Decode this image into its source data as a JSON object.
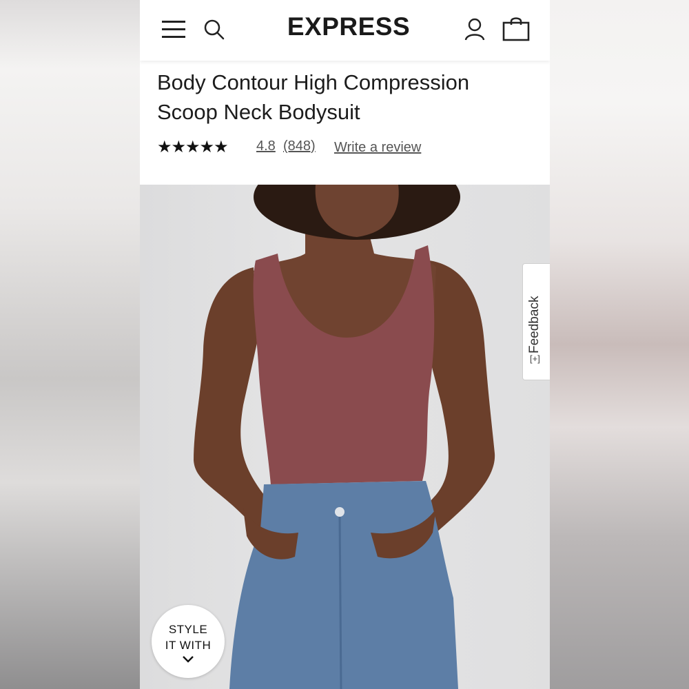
{
  "header": {
    "brand": "EXPRESS"
  },
  "product": {
    "title_line1": "Body Contour High Compression",
    "title_line2": "Scoop Neck Bodysuit",
    "stars": "★★★★★",
    "rating": "4.8",
    "review_count": "(848)",
    "write_review": "Write a review"
  },
  "feedback": {
    "label": "Feedback",
    "icon": "[+]"
  },
  "style_with": {
    "line1": "STYLE",
    "line2": "IT WITH"
  },
  "colors": {
    "bodysuit": "#8a4b4e",
    "denim": "#5d7ea6",
    "skin": "#6b3f2b",
    "backdrop": "#e0e0e1"
  }
}
